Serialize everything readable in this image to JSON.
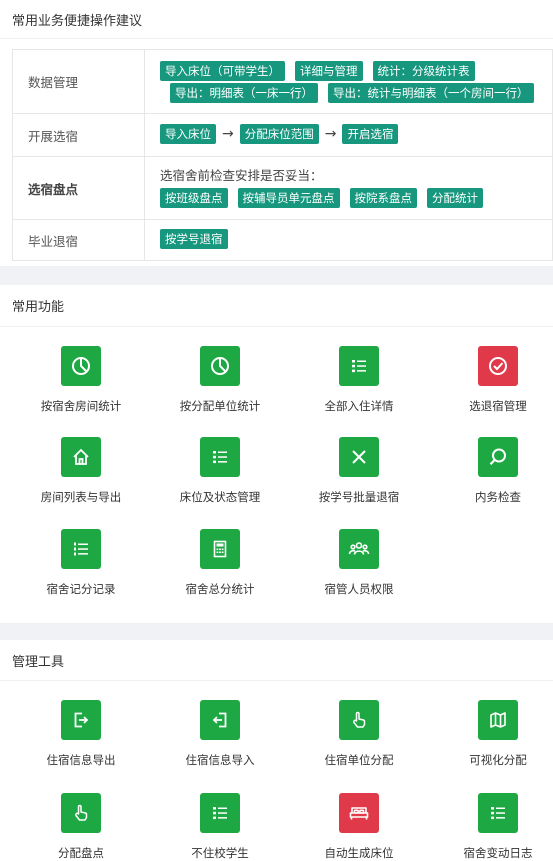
{
  "suggestions": {
    "title": "常用业务便捷操作建议",
    "rows": [
      {
        "label": "数据管理",
        "lines": [
          [
            "导入床位（可带学生）",
            "详细与管理",
            "统计：分级统计表"
          ],
          [
            "导出：明细表（一床一行）",
            "导出：统计与明细表（一个房间一行）"
          ]
        ]
      },
      {
        "label": "开展选宿",
        "steps": [
          "导入床位",
          "分配床位范围",
          "开启选宿"
        ],
        "arrow": "→"
      },
      {
        "label": "选宿盘点",
        "note": "选宿舍前检查安排是否妥当：",
        "chips": [
          "按班级盘点",
          "按辅导员单元盘点",
          "按院系盘点",
          "分配统计"
        ]
      },
      {
        "label": "毕业退宿",
        "chips": [
          "按学号退宿"
        ]
      }
    ]
  },
  "functions": {
    "title": "常用功能",
    "items": [
      {
        "label": "按宿舍房间统计",
        "icon": "pie-chart-icon",
        "color": "#1da843"
      },
      {
        "label": "按分配单位统计",
        "icon": "pie-chart-icon",
        "color": "#1da843"
      },
      {
        "label": "全部入住详情",
        "icon": "list-icon",
        "color": "#1da843"
      },
      {
        "label": "选退宿管理",
        "icon": "check-circle-icon",
        "color": "#e03a4a"
      },
      {
        "label": "房间列表与导出",
        "icon": "home-icon",
        "color": "#1da843"
      },
      {
        "label": "床位及状态管理",
        "icon": "list-icon",
        "color": "#1da843"
      },
      {
        "label": "按学号批量退宿",
        "icon": "close-icon",
        "color": "#1da843"
      },
      {
        "label": "内务检查",
        "icon": "search-icon",
        "color": "#1da843"
      },
      {
        "label": "宿舍记分记录",
        "icon": "ordered-list-icon",
        "color": "#1da843"
      },
      {
        "label": "宿舍总分统计",
        "icon": "calculator-icon",
        "color": "#1da843"
      },
      {
        "label": "宿管人员权限",
        "icon": "team-icon",
        "color": "#1da843"
      }
    ]
  },
  "tools": {
    "title": "管理工具",
    "items": [
      {
        "label": "住宿信息导出",
        "icon": "export-icon",
        "color": "#1da843"
      },
      {
        "label": "住宿信息导入",
        "icon": "import-icon",
        "color": "#1da843"
      },
      {
        "label": "住宿单位分配",
        "icon": "pointer-hand-icon",
        "color": "#1da843"
      },
      {
        "label": "可视化分配",
        "icon": "map-icon",
        "color": "#1da843"
      },
      {
        "label": "分配盘点",
        "icon": "pointer-hand-icon",
        "color": "#1da843"
      },
      {
        "label": "不住校学生",
        "icon": "list-icon",
        "color": "#1da843"
      },
      {
        "label": "自动生成床位",
        "icon": "bed-icon",
        "color": "#e03a4a"
      },
      {
        "label": "宿舍变动日志",
        "icon": "list-icon",
        "color": "#1da843"
      }
    ]
  }
}
